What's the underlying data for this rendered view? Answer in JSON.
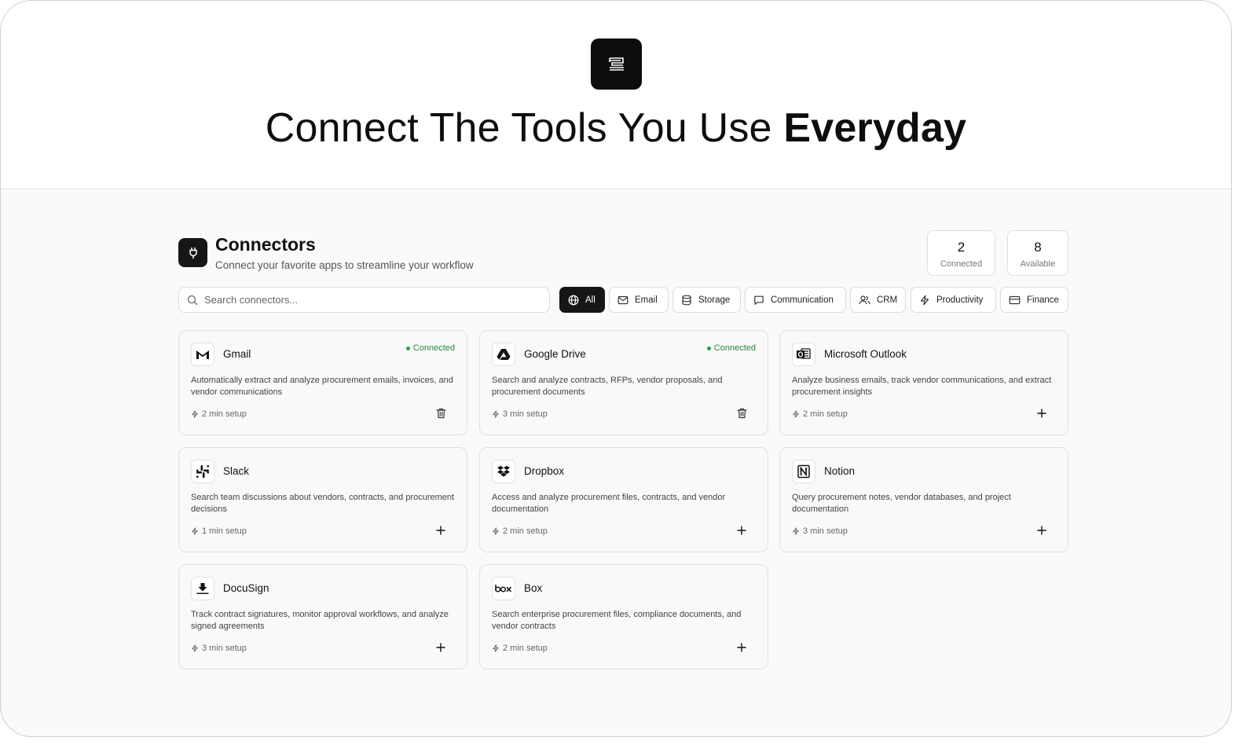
{
  "hero": {
    "title_main": "Connect The Tools You Use ",
    "title_bold": "Everyday"
  },
  "header": {
    "title": "Connectors",
    "subtitle": "Connect your favorite apps to streamline your workflow"
  },
  "stats": [
    {
      "value": "2",
      "label": "Connected"
    },
    {
      "value": "8",
      "label": "Available"
    }
  ],
  "search": {
    "placeholder": "Search connectors..."
  },
  "filters": [
    {
      "label": "All",
      "icon": "globe-icon",
      "active": true
    },
    {
      "label": "Email",
      "icon": "mail-icon",
      "active": false
    },
    {
      "label": "Storage",
      "icon": "database-icon",
      "active": false
    },
    {
      "label": "Communication",
      "icon": "message-icon",
      "active": false
    },
    {
      "label": "CRM",
      "icon": "users-icon",
      "active": false
    },
    {
      "label": "Productivity",
      "icon": "zap-icon",
      "active": false
    },
    {
      "label": "Finance",
      "icon": "credit-card-icon",
      "active": false
    }
  ],
  "connectors": [
    {
      "name": "Gmail",
      "status": "Connected",
      "description": "Automatically extract and analyze procurement emails, invoices, and vendor communications",
      "setup": "2 min setup",
      "icon": "gmail-icon",
      "action": "delete"
    },
    {
      "name": "Google Drive",
      "status": "Connected",
      "description": "Search and analyze contracts, RFPs, vendor proposals, and procurement documents",
      "setup": "3 min setup",
      "icon": "google-drive-icon",
      "action": "delete"
    },
    {
      "name": "Microsoft Outlook",
      "status": "",
      "description": "Analyze business emails, track vendor communications, and extract procurement insights",
      "setup": "2 min setup",
      "icon": "outlook-icon",
      "action": "add"
    },
    {
      "name": "Slack",
      "status": "",
      "description": "Search team discussions about vendors, contracts, and procurement decisions",
      "setup": "1 min setup",
      "icon": "slack-icon",
      "action": "add"
    },
    {
      "name": "Dropbox",
      "status": "",
      "description": "Access and analyze procurement files, contracts, and vendor documentation",
      "setup": "2 min setup",
      "icon": "dropbox-icon",
      "action": "add"
    },
    {
      "name": "Notion",
      "status": "",
      "description": "Query procurement notes, vendor databases, and project documentation",
      "setup": "3 min setup",
      "icon": "notion-icon",
      "action": "add"
    },
    {
      "name": "DocuSign",
      "status": "",
      "description": "Track contract signatures, monitor approval workflows, and analyze signed agreements",
      "setup": "3 min setup",
      "icon": "docusign-icon",
      "action": "add"
    },
    {
      "name": "Box",
      "status": "",
      "description": "Search enterprise procurement files, compliance documents, and vendor contracts",
      "setup": "2 min setup",
      "icon": "box-icon",
      "action": "add"
    }
  ]
}
